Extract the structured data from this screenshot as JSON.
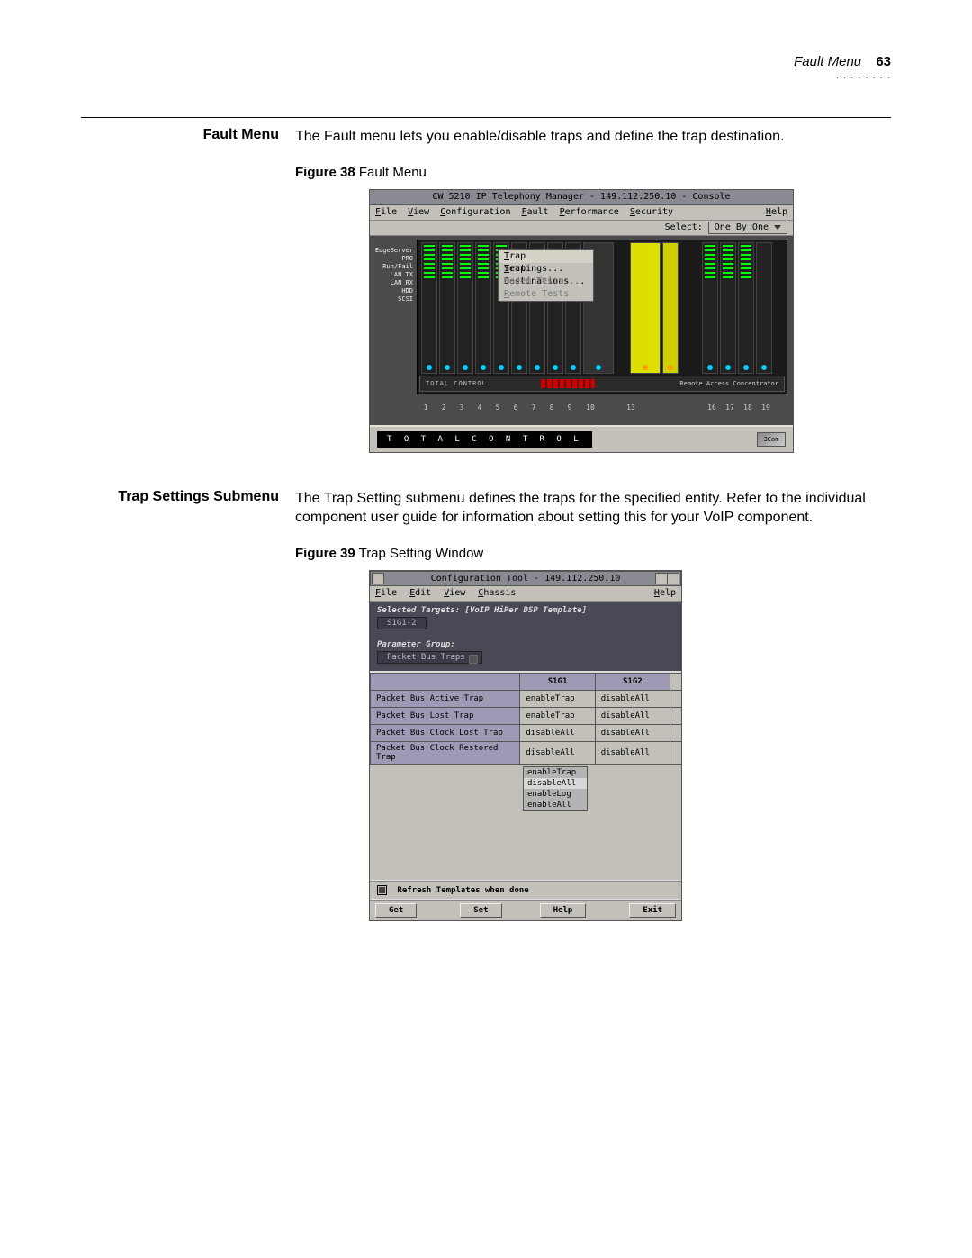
{
  "header": {
    "section": "Fault Menu",
    "page": "63"
  },
  "s1": {
    "heading": "Fault Menu",
    "body": "The Fault menu lets you enable/disable traps and define the trap destination."
  },
  "fig38": {
    "caption_b": "Figure 38",
    "caption": "  Fault Menu",
    "title": "CW 5210 IP Telephony Manager - 149.112.250.10 - Console",
    "menu": {
      "file": "File",
      "view": "View",
      "config": "Configuration",
      "fault": "Fault",
      "perf": "Performance",
      "sec": "Security",
      "help": "Help"
    },
    "dd": {
      "i1": "Trap Settings...",
      "i2": "Trap Destinations...",
      "i3": "Modem Tests...",
      "i4": "Remote Tests"
    },
    "select_label": "Select:",
    "select_value": "One By One",
    "labels": [
      "EdgeServer",
      "PRO",
      "Run/Fail",
      "LAN TX",
      "LAN RX",
      "HDD",
      "SCSI"
    ],
    "slot_nums": [
      "1",
      "2",
      "3",
      "4",
      "5",
      "6",
      "7",
      "8",
      "9",
      "10",
      "13",
      "16",
      "17",
      "18",
      "19"
    ],
    "tc_bar": "TOTAL CONTROL",
    "tc_foot": "T  O  T  A  L    C  O  N  T  R  O  L",
    "rac": "Remote Access Concentrator",
    "logo": "3Com"
  },
  "s2": {
    "heading": "Trap Settings Submenu",
    "body": "The Trap Setting submenu defines the traps for the specified entity. Refer to the individual component user guide for information about setting this for your VoIP component."
  },
  "fig39": {
    "caption_b": "Figure 39",
    "caption": "  Trap Setting Window",
    "title": "Configuration Tool - 149.112.250.10",
    "menu": {
      "file": "File",
      "edit": "Edit",
      "view": "View",
      "chassis": "Chassis",
      "help": "Help"
    },
    "sel_label": "Selected Targets:  [VoIP HiPer DSP Template]",
    "sel_box": "S1G1-2",
    "pg_label": "Parameter Group:",
    "pg_box": "Packet Bus Traps",
    "cols": {
      "c0": "",
      "c1": "S1G1",
      "c2": "S1G2"
    },
    "rows": [
      {
        "n": "Packet Bus Active Trap",
        "a": "enableTrap",
        "b": "disableAll"
      },
      {
        "n": "Packet Bus Lost Trap",
        "a": "enableTrap",
        "b": "disableAll"
      },
      {
        "n": "Packet Bus Clock Lost Trap",
        "a": "disableAll",
        "b": "disableAll"
      },
      {
        "n": "Packet Bus Clock Restored Trap",
        "a": "disableAll",
        "b": "disableAll"
      }
    ],
    "popup": [
      "enableTrap",
      "disableAll",
      "enableLog",
      "enableAll"
    ],
    "refresh": "Refresh Templates when done",
    "btns": {
      "get": "Get",
      "set": "Set",
      "help": "Help",
      "exit": "Exit"
    }
  }
}
